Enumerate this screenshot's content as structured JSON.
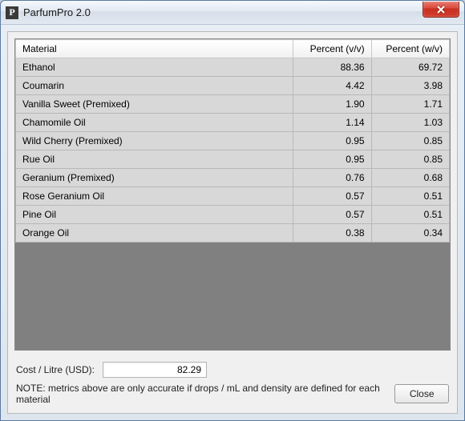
{
  "window": {
    "title": "ParfumPro 2.0",
    "icon_letter": "P"
  },
  "table": {
    "headers": {
      "material": "Material",
      "percent_vv": "Percent (v/v)",
      "percent_wv": "Percent (w/v)"
    },
    "rows": [
      {
        "material": "Ethanol",
        "vv": "88.36",
        "wv": "69.72"
      },
      {
        "material": "Coumarin",
        "vv": "4.42",
        "wv": "3.98"
      },
      {
        "material": "Vanilla Sweet (Premixed)",
        "vv": "1.90",
        "wv": "1.71"
      },
      {
        "material": "Chamomile Oil",
        "vv": "1.14",
        "wv": "1.03"
      },
      {
        "material": "Wild Cherry (Premixed)",
        "vv": "0.95",
        "wv": "0.85"
      },
      {
        "material": "Rue Oil",
        "vv": "0.95",
        "wv": "0.85"
      },
      {
        "material": "Geranium (Premixed)",
        "vv": "0.76",
        "wv": "0.68"
      },
      {
        "material": "Rose Geranium Oil",
        "vv": "0.57",
        "wv": "0.51"
      },
      {
        "material": "Pine Oil",
        "vv": "0.57",
        "wv": "0.51"
      },
      {
        "material": "Orange Oil",
        "vv": "0.38",
        "wv": "0.34"
      }
    ]
  },
  "footer": {
    "cost_label": "Cost / Litre (USD):",
    "cost_value": "82.29",
    "note": "NOTE: metrics above are only accurate if drops / mL and density are defined for each material",
    "close_label": "Close"
  }
}
